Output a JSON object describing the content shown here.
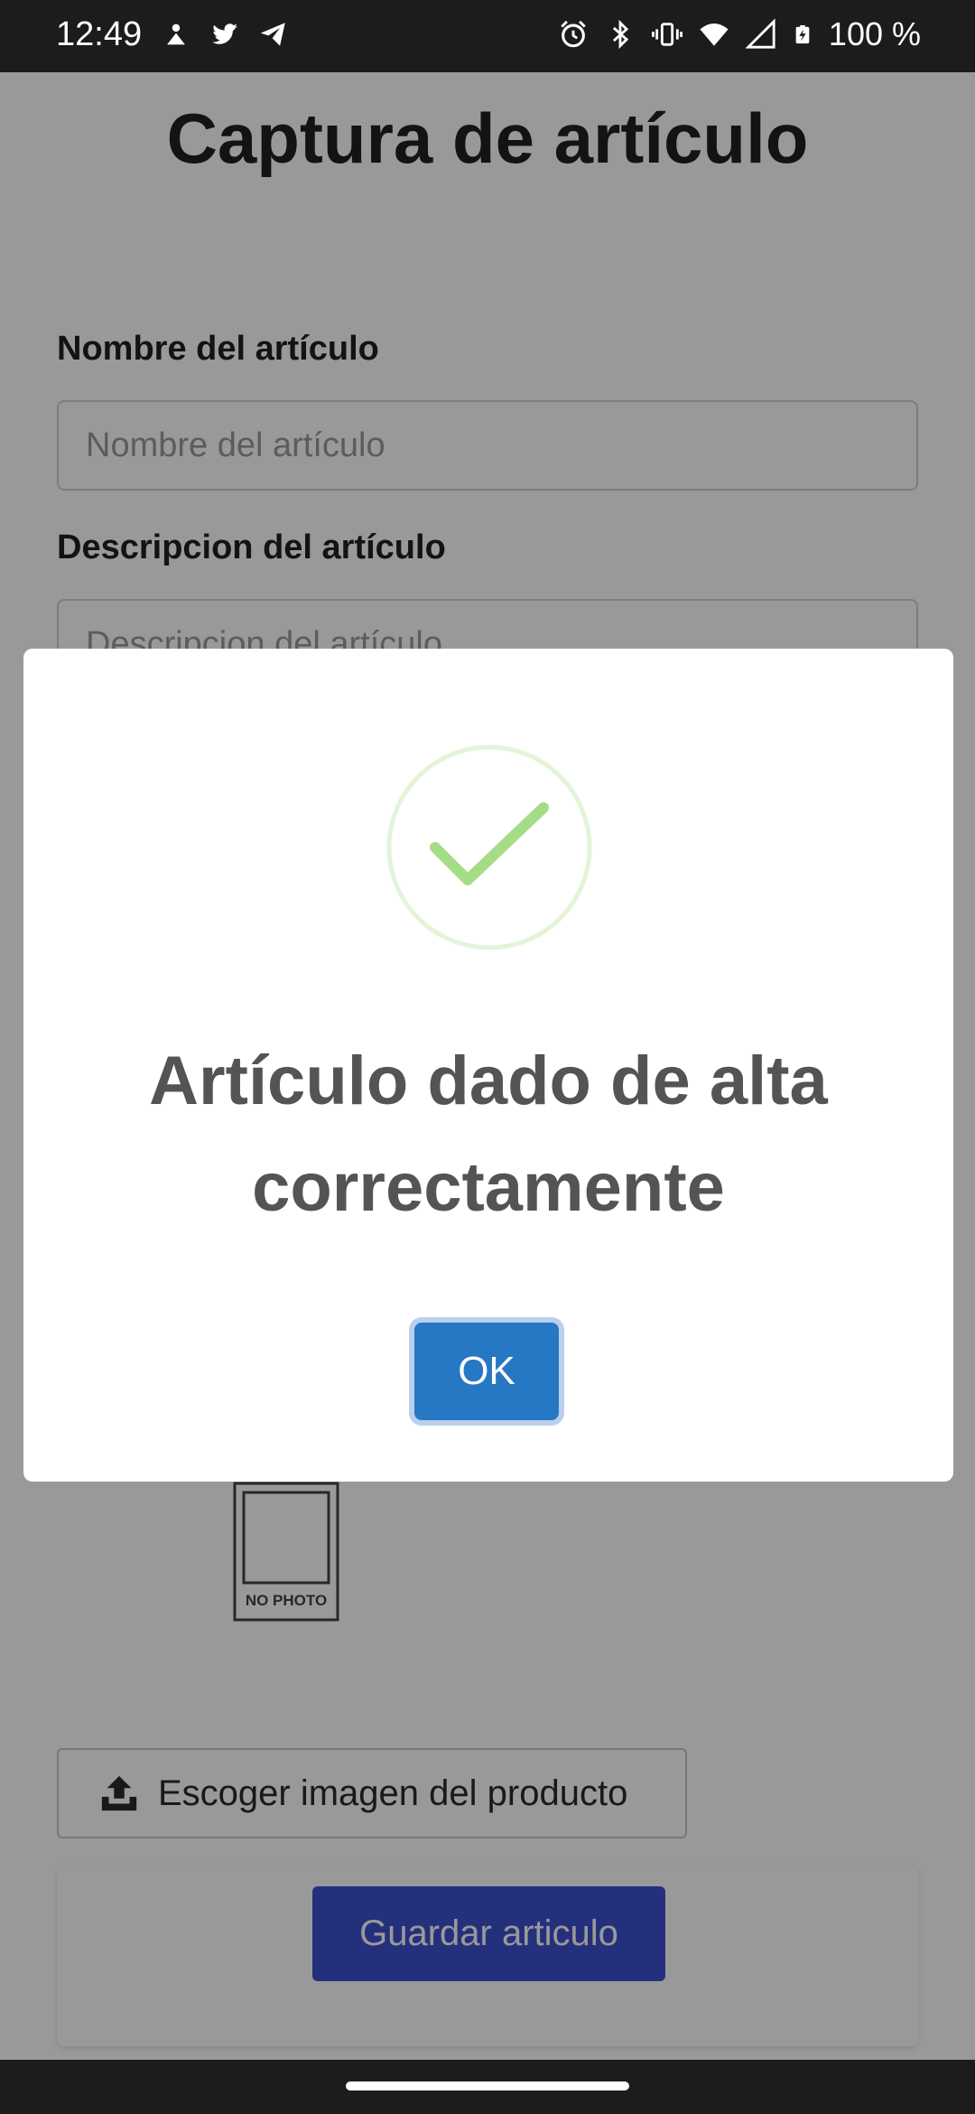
{
  "status_bar": {
    "time": "12:49",
    "battery_text": "100 %",
    "left_icons": [
      "notification-icon",
      "twitter-icon",
      "telegram-icon"
    ],
    "right_icons": [
      "alarm-icon",
      "bluetooth-icon",
      "vibrate-icon",
      "wifi-icon",
      "cellular-icon",
      "battery-charging-icon"
    ]
  },
  "page": {
    "title": "Captura de artículo",
    "name_label": "Nombre del artículo",
    "name_placeholder": "Nombre del artículo",
    "description_label": "Descripcion del artículo",
    "description_placeholder": "Descripcion del artículo",
    "no_photo_text": "NO PHOTO",
    "upload_label": "Escoger imagen del producto",
    "save_label": "Guardar articulo"
  },
  "modal": {
    "title": "Artículo dado de alta correctamente",
    "ok_label": "OK"
  },
  "colors": {
    "success_green": "#a5dc86",
    "ok_blue": "#2778c4",
    "save_blue": "#3f51d0"
  }
}
